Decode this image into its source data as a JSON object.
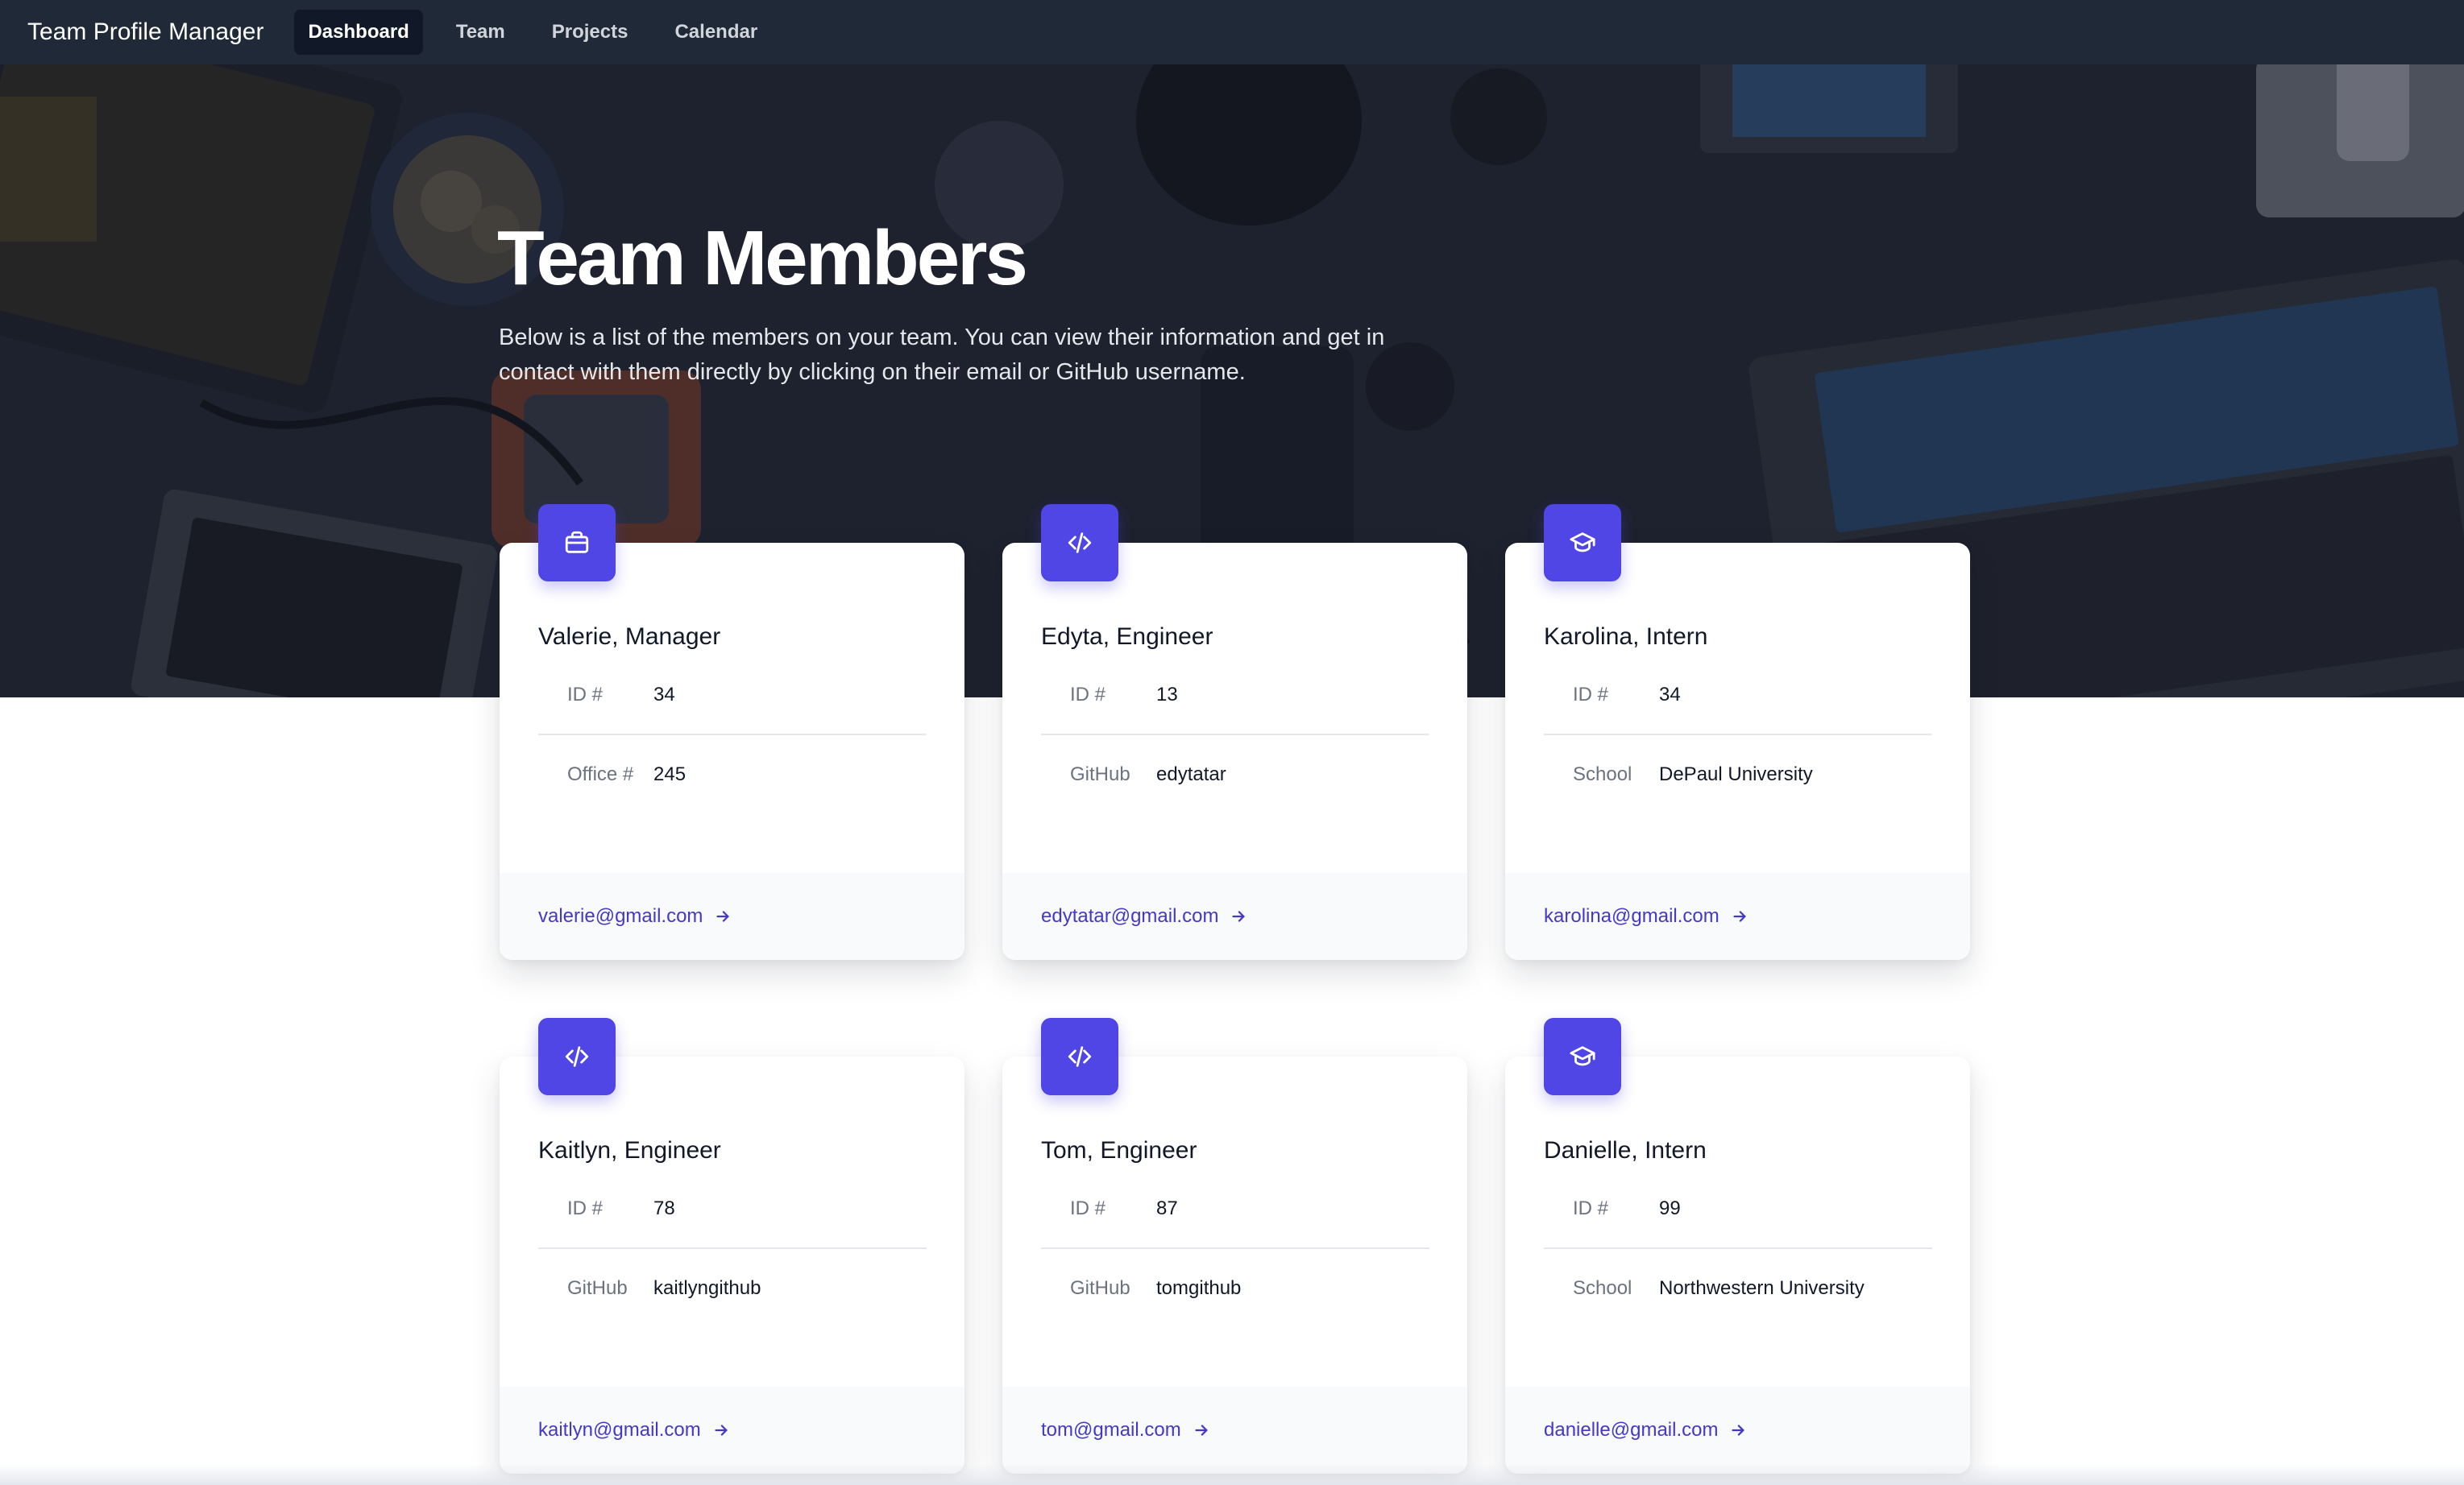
{
  "navbar": {
    "brand": "Team Profile Manager",
    "links": [
      {
        "label": "Dashboard",
        "active": true
      },
      {
        "label": "Team",
        "active": false
      },
      {
        "label": "Projects",
        "active": false
      },
      {
        "label": "Calendar",
        "active": false
      }
    ]
  },
  "hero": {
    "title": "Team Members",
    "description": "Below is a list of the members on your team. You can view their information and get in contact with them directly by clicking on their email or GitHub username."
  },
  "cards": [
    {
      "icon": "briefcase-icon",
      "title": "Valerie, Manager",
      "id_label": "ID #",
      "id": "34",
      "field_label": "Office #",
      "field_value": "245",
      "email": "valerie@gmail.com"
    },
    {
      "icon": "code-icon",
      "title": "Edyta, Engineer",
      "id_label": "ID #",
      "id": "13",
      "field_label": "GitHub",
      "field_value": "edytatar",
      "email": "edytatar@gmail.com"
    },
    {
      "icon": "graduation-cap-icon",
      "title": "Karolina, Intern",
      "id_label": "ID #",
      "id": "34",
      "field_label": "School",
      "field_value": "DePaul University",
      "email": "karolina@gmail.com"
    },
    {
      "icon": "code-icon",
      "title": "Kaitlyn, Engineer",
      "id_label": "ID #",
      "id": "78",
      "field_label": "GitHub",
      "field_value": "kaitlyngithub",
      "email": "kaitlyn@gmail.com"
    },
    {
      "icon": "code-icon",
      "title": "Tom, Engineer",
      "id_label": "ID #",
      "id": "87",
      "field_label": "GitHub",
      "field_value": "tomgithub",
      "email": "tom@gmail.com"
    },
    {
      "icon": "graduation-cap-icon",
      "title": "Danielle, Intern",
      "id_label": "ID #",
      "id": "99",
      "field_label": "School",
      "field_value": "Northwestern University",
      "email": "danielle@gmail.com"
    }
  ],
  "colors": {
    "navbar": "#1f2937",
    "accent": "#4f46e5",
    "link": "#4338ca"
  }
}
